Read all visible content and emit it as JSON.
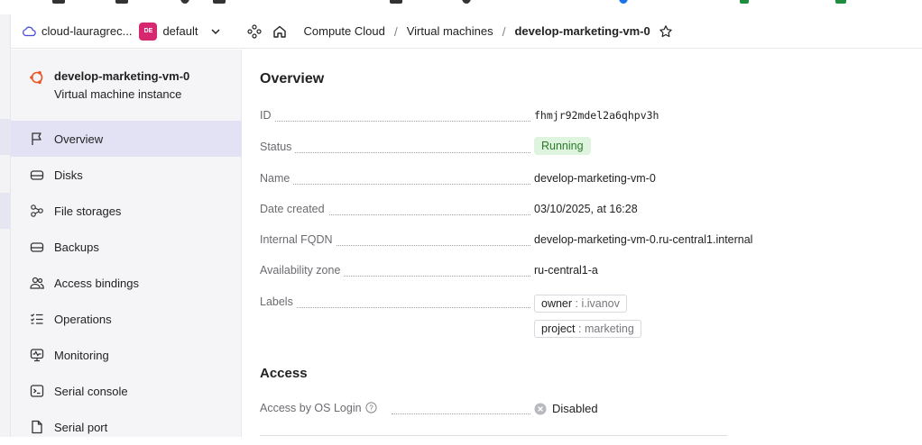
{
  "header": {
    "cloud_name": "cloud-lauragrec...",
    "folder_badge": "DE",
    "folder_name": "default",
    "breadcrumbs": [
      "Compute Cloud",
      "Virtual machines",
      "develop-marketing-vm-0"
    ]
  },
  "sidebar": {
    "resource_title": "develop-marketing-vm-0",
    "resource_subtitle": "Virtual machine instance",
    "items": [
      {
        "label": "Overview",
        "icon": "flag-icon",
        "active": true
      },
      {
        "label": "Disks",
        "icon": "disk-icon"
      },
      {
        "label": "File storages",
        "icon": "nodes-icon"
      },
      {
        "label": "Backups",
        "icon": "backup-icon"
      },
      {
        "label": "Access bindings",
        "icon": "users-icon"
      },
      {
        "label": "Operations",
        "icon": "list-icon"
      },
      {
        "label": "Monitoring",
        "icon": "monitor-icon"
      },
      {
        "label": "Serial console",
        "icon": "terminal-icon"
      },
      {
        "label": "Serial port",
        "icon": "file-icon"
      }
    ]
  },
  "overview": {
    "title": "Overview",
    "id_label": "ID",
    "id_value": "fhmjr92mdel2a6qhpv3h",
    "status_label": "Status",
    "status_value": "Running",
    "name_label": "Name",
    "name_value": "develop-marketing-vm-0",
    "date_label": "Date created",
    "date_value": "03/10/2025, at 16:28",
    "fqdn_label": "Internal FQDN",
    "fqdn_value": "develop-marketing-vm-0.ru-central1.internal",
    "zone_label": "Availability zone",
    "zone_value": "ru-central1-a",
    "labels_label": "Labels",
    "labels": [
      {
        "key": "owner",
        "value": "i.ivanov"
      },
      {
        "key": "project",
        "value": "marketing"
      }
    ]
  },
  "access": {
    "title": "Access",
    "os_login_label": "Access by OS Login",
    "os_login_value": "Disabled"
  },
  "colors": {
    "accent": "#e2e2f4",
    "running_bg": "#dff4de",
    "running_fg": "#2a7a2a",
    "folder_badge": "#d6286f",
    "ubuntu": "#e95420"
  }
}
